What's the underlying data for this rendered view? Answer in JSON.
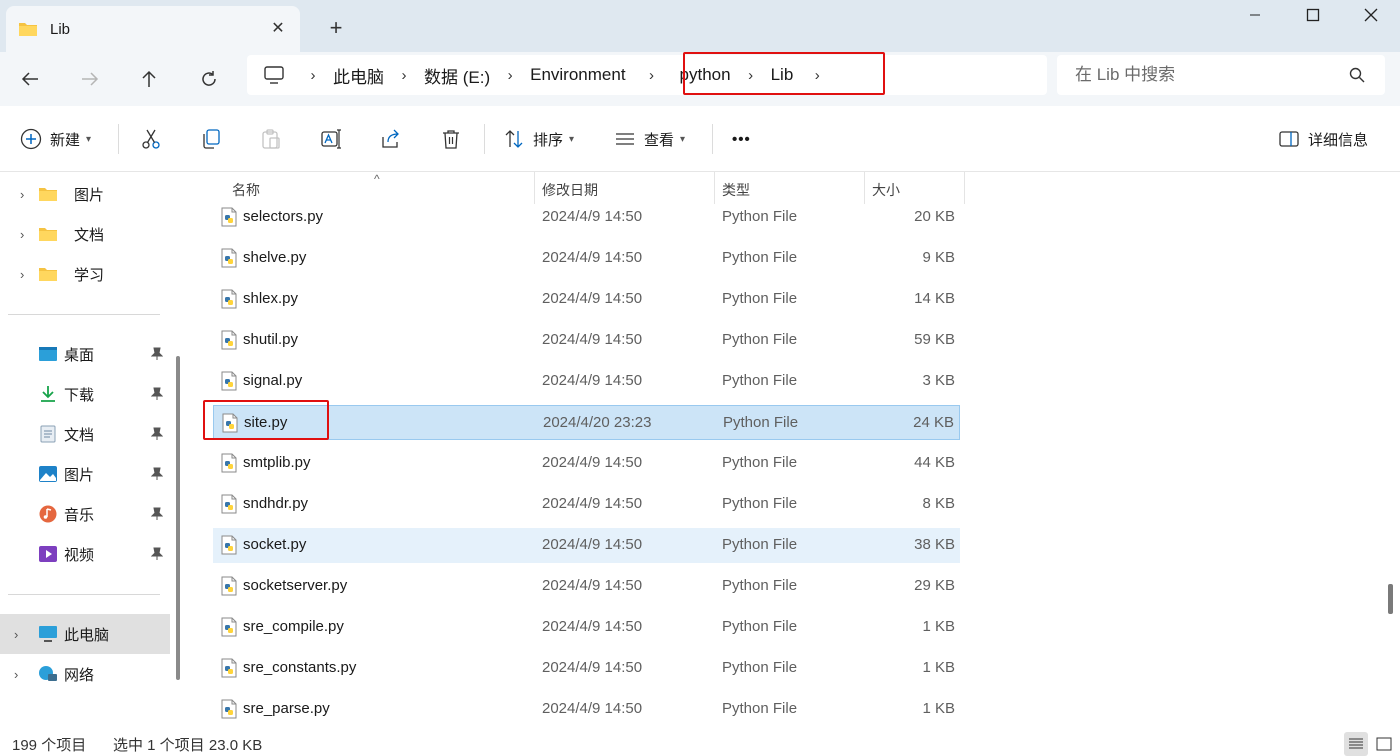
{
  "tab": {
    "title": "Lib",
    "close": "✕",
    "new": "+"
  },
  "breadcrumbs": [
    "此电脑",
    "数据 (E:)",
    "Environment",
    "python",
    "Lib"
  ],
  "search": {
    "placeholder": "在 Lib 中搜索"
  },
  "toolbar": {
    "new_label": "新建",
    "sort_label": "排序",
    "view_label": "查看",
    "more_label": "•••",
    "details_label": "详细信息"
  },
  "sidebar": {
    "folders": [
      {
        "label": "图片",
        "icon": "folder-icon"
      },
      {
        "label": "文档",
        "icon": "folder-icon"
      },
      {
        "label": "学习",
        "icon": "folder-icon"
      }
    ],
    "quick_access": [
      {
        "label": "桌面",
        "icon": "desktop-icon"
      },
      {
        "label": "下载",
        "icon": "download-icon"
      },
      {
        "label": "文档",
        "icon": "documents-icon"
      },
      {
        "label": "图片",
        "icon": "pictures-icon"
      },
      {
        "label": "音乐",
        "icon": "music-icon"
      },
      {
        "label": "视频",
        "icon": "video-icon"
      }
    ],
    "this_pc": "此电脑",
    "network": "网络"
  },
  "columns": {
    "name": "名称",
    "date": "修改日期",
    "type": "类型",
    "size": "大小"
  },
  "files": [
    {
      "name": "selectors.py",
      "date": "2024/4/9 14:50",
      "type": "Python File",
      "size": "20 KB"
    },
    {
      "name": "shelve.py",
      "date": "2024/4/9 14:50",
      "type": "Python File",
      "size": "9 KB"
    },
    {
      "name": "shlex.py",
      "date": "2024/4/9 14:50",
      "type": "Python File",
      "size": "14 KB"
    },
    {
      "name": "shutil.py",
      "date": "2024/4/9 14:50",
      "type": "Python File",
      "size": "59 KB"
    },
    {
      "name": "signal.py",
      "date": "2024/4/9 14:50",
      "type": "Python File",
      "size": "3 KB"
    },
    {
      "name": "site.py",
      "date": "2024/4/20 23:23",
      "type": "Python File",
      "size": "24 KB"
    },
    {
      "name": "smtplib.py",
      "date": "2024/4/9 14:50",
      "type": "Python File",
      "size": "44 KB"
    },
    {
      "name": "sndhdr.py",
      "date": "2024/4/9 14:50",
      "type": "Python File",
      "size": "8 KB"
    },
    {
      "name": "socket.py",
      "date": "2024/4/9 14:50",
      "type": "Python File",
      "size": "38 KB"
    },
    {
      "name": "socketserver.py",
      "date": "2024/4/9 14:50",
      "type": "Python File",
      "size": "29 KB"
    },
    {
      "name": "sre_compile.py",
      "date": "2024/4/9 14:50",
      "type": "Python File",
      "size": "1 KB"
    },
    {
      "name": "sre_constants.py",
      "date": "2024/4/9 14:50",
      "type": "Python File",
      "size": "1 KB"
    },
    {
      "name": "sre_parse.py",
      "date": "2024/4/9 14:50",
      "type": "Python File",
      "size": "1 KB"
    }
  ],
  "selected_file": "site.py",
  "hovered_file": "socket.py",
  "status": {
    "item_count": "199 个项目",
    "selection": "选中 1 个项目  23.0 KB"
  },
  "colors": {
    "accent": "#0067c0",
    "selection": "#cce4f7",
    "highlight_box": "#e01010"
  }
}
